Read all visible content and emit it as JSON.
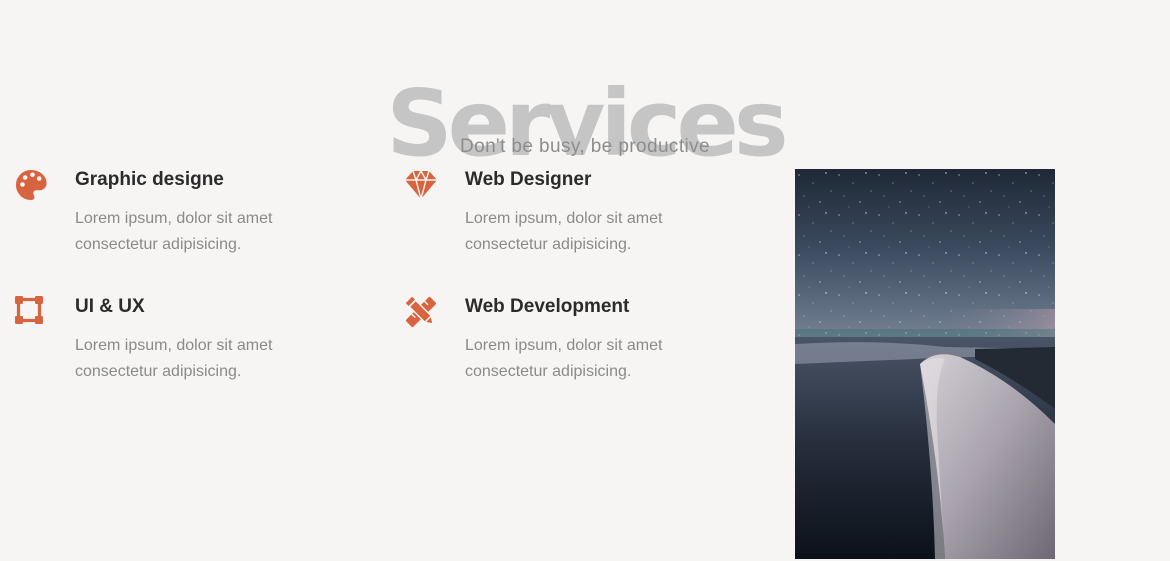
{
  "header": {
    "title": "Services",
    "subtitle": "Don't be busy, be productive"
  },
  "services": [
    {
      "icon": "palette-icon",
      "title": "Graphic designe",
      "description": "Lorem ipsum, dolor sit amet consectetur adipisicing."
    },
    {
      "icon": "diamond-icon",
      "title": "Web Designer",
      "description": "Lorem ipsum, dolor sit amet consectetur adipisicing."
    },
    {
      "icon": "vector-square-icon",
      "title": "UI & UX",
      "description": "Lorem ipsum, dolor sit amet consectetur adipisicing."
    },
    {
      "icon": "pencil-ruler-icon",
      "title": "Web Development",
      "description": "Lorem ipsum, dolor sit amet consectetur adipisicing."
    }
  ],
  "image": {
    "subject": "snowy-dune-under-starry-night"
  },
  "colors": {
    "accent": "#d8643f",
    "heading": "#c5c5c5",
    "subtitle": "#8d8d8d",
    "title": "#2b2b2b",
    "text": "#8a8a8a",
    "background": "#f6f5f3"
  }
}
